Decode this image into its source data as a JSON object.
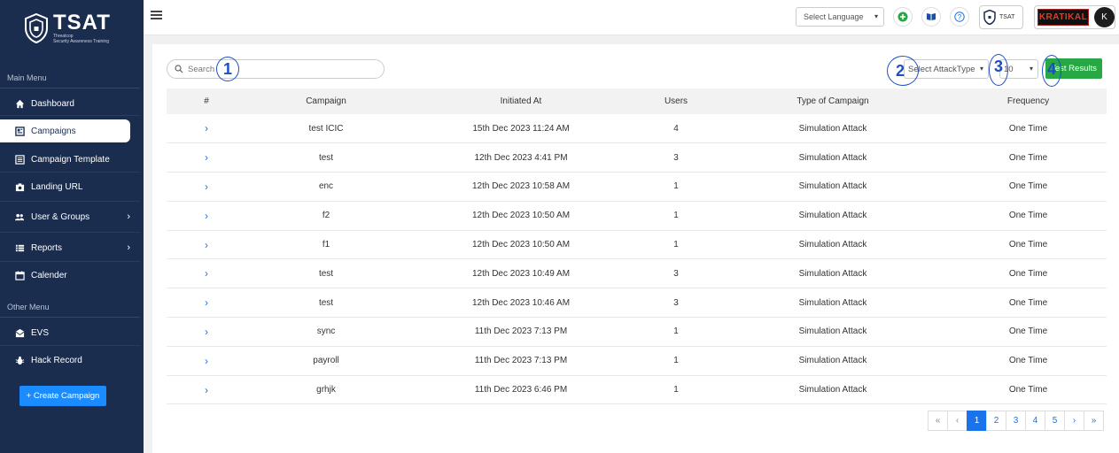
{
  "brand": {
    "title": "TSAT",
    "subtitle_line1": "Threatcop",
    "subtitle_line2": "Security Awareness Training"
  },
  "sidebar": {
    "main_label": "Main Menu",
    "other_label": "Other Menu",
    "items": [
      {
        "label": "Dashboard",
        "icon": "home-icon"
      },
      {
        "label": "Campaigns",
        "icon": "campaign-icon",
        "active": true
      },
      {
        "label": "Campaign Template",
        "icon": "template-icon"
      },
      {
        "label": "Landing URL",
        "icon": "camera-icon"
      },
      {
        "label": "User & Groups",
        "icon": "users-icon",
        "expandable": true
      },
      {
        "label": "Reports",
        "icon": "list-icon",
        "expandable": true
      },
      {
        "label": "Calender",
        "icon": "calendar-icon"
      }
    ],
    "other_items": [
      {
        "label": "EVS",
        "icon": "mail-icon"
      },
      {
        "label": "Hack Record",
        "icon": "bug-icon"
      }
    ],
    "create_button": "+ Create Campaign"
  },
  "header": {
    "language_select": "Select Language",
    "tsat_chip": "TSAT",
    "brand_logo": "KRATIKAL",
    "avatar_initial": "K"
  },
  "toolbar": {
    "search_placeholder": "Search",
    "attack_type": "Select AttackType",
    "per_page": "10",
    "test_results": "Test Results",
    "markers": [
      "1",
      "2",
      "3",
      "4"
    ]
  },
  "table": {
    "columns": [
      "#",
      "Campaign",
      "Initiated At",
      "Users",
      "Type of Campaign",
      "Frequency"
    ],
    "rows": [
      {
        "campaign": "test ICIC",
        "initiated": "15th Dec 2023 11:24 AM",
        "users": "4",
        "type": "Simulation Attack",
        "frequency": "One Time"
      },
      {
        "campaign": "test",
        "initiated": "12th Dec 2023 4:41 PM",
        "users": "3",
        "type": "Simulation Attack",
        "frequency": "One Time"
      },
      {
        "campaign": "enc",
        "initiated": "12th Dec 2023 10:58 AM",
        "users": "1",
        "type": "Simulation Attack",
        "frequency": "One Time"
      },
      {
        "campaign": "f2",
        "initiated": "12th Dec 2023 10:50 AM",
        "users": "1",
        "type": "Simulation Attack",
        "frequency": "One Time"
      },
      {
        "campaign": "f1",
        "initiated": "12th Dec 2023 10:50 AM",
        "users": "1",
        "type": "Simulation Attack",
        "frequency": "One Time"
      },
      {
        "campaign": "test",
        "initiated": "12th Dec 2023 10:49 AM",
        "users": "3",
        "type": "Simulation Attack",
        "frequency": "One Time"
      },
      {
        "campaign": "test",
        "initiated": "12th Dec 2023 10:46 AM",
        "users": "3",
        "type": "Simulation Attack",
        "frequency": "One Time"
      },
      {
        "campaign": "sync",
        "initiated": "11th Dec 2023 7:13 PM",
        "users": "1",
        "type": "Simulation Attack",
        "frequency": "One Time"
      },
      {
        "campaign": "payroll",
        "initiated": "11th Dec 2023 7:13 PM",
        "users": "1",
        "type": "Simulation Attack",
        "frequency": "One Time"
      },
      {
        "campaign": "grhjk",
        "initiated": "11th Dec 2023 6:46 PM",
        "users": "1",
        "type": "Simulation Attack",
        "frequency": "One Time"
      }
    ]
  },
  "pagination": {
    "first": "«",
    "prev": "‹",
    "pages": [
      "1",
      "2",
      "3",
      "4",
      "5"
    ],
    "current": "1",
    "next": "›",
    "last": "»"
  },
  "colors": {
    "sidebar": "#1b2d4f",
    "accent": "#1a8cff",
    "success": "#28a745",
    "link": "#1a73e8"
  }
}
